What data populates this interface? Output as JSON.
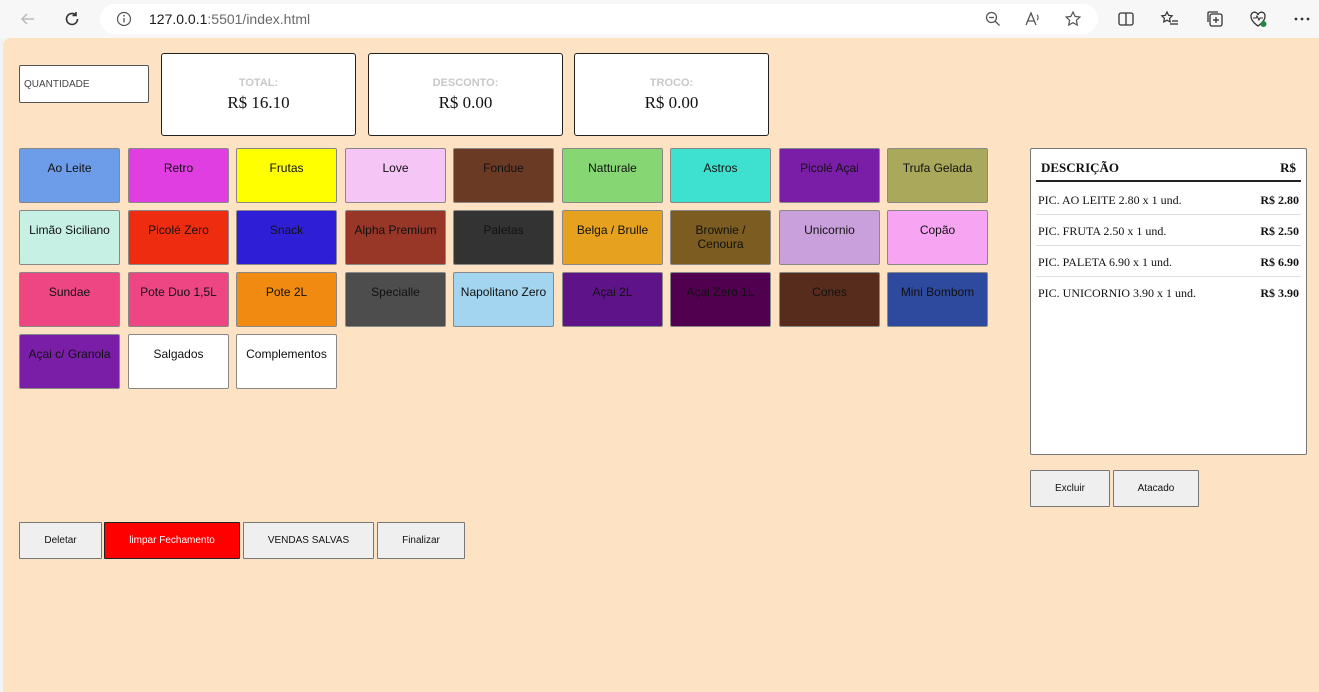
{
  "browser": {
    "url_host": "127.0.0.1",
    "url_path": ":5501/index.html"
  },
  "quantity": {
    "placeholder": "QUANTIDADE"
  },
  "summary": [
    {
      "label": "TOTAL:",
      "value": "R$ 16.10"
    },
    {
      "label": "DESCONTO:",
      "value": "R$ 0.00"
    },
    {
      "label": "TROCO:",
      "value": "R$ 0.00"
    }
  ],
  "products": [
    {
      "label": "Ao Leite",
      "color": "#6d9de8"
    },
    {
      "label": "Retro",
      "color": "#e03ee0"
    },
    {
      "label": "Frutas",
      "color": "#ffff00"
    },
    {
      "label": "Love",
      "color": "#f5c5f5"
    },
    {
      "label": "Fondue",
      "color": "#6b3a25"
    },
    {
      "label": "Natturale",
      "color": "#86d674"
    },
    {
      "label": "Astros",
      "color": "#3ee0d0"
    },
    {
      "label": "Picolé Açai",
      "color": "#7a1ea8"
    },
    {
      "label": "Trufa Gelada",
      "color": "#aaa85a"
    },
    {
      "label": "Limão Siciliano",
      "color": "#c6f0e3"
    },
    {
      "label": "Picolé Zero",
      "color": "#ee2d10"
    },
    {
      "label": "Snack",
      "color": "#2e1fd6"
    },
    {
      "label": "Alpha Premium",
      "color": "#983728"
    },
    {
      "label": "Paletas",
      "color": "#333333"
    },
    {
      "label": "Belga / Brulle",
      "color": "#e6a21e"
    },
    {
      "label": "Brownie / Cenoura",
      "color": "#7c5c20"
    },
    {
      "label": "Unicornio",
      "color": "#c9a0dc"
    },
    {
      "label": "Copão",
      "color": "#f7a5f3"
    },
    {
      "label": "Sundae",
      "color": "#ee4583"
    },
    {
      "label": "Pote Duo 1,5L",
      "color": "#ee4583"
    },
    {
      "label": "Pote 2L",
      "color": "#f08a10"
    },
    {
      "label": "Specialle",
      "color": "#4d4d4d"
    },
    {
      "label": "Napolitano Zero",
      "color": "#a3d5f0"
    },
    {
      "label": "Açai 2L",
      "color": "#5e1488"
    },
    {
      "label": "Açai Zero 1L",
      "color": "#51004f"
    },
    {
      "label": "Cones",
      "color": "#582c1c"
    },
    {
      "label": "Mini Bombom",
      "color": "#2e4a9e"
    },
    {
      "label": "Açai c/ Granola",
      "color": "#7a1ea8"
    },
    {
      "label": "Salgados",
      "color": "#ffffff"
    },
    {
      "label": "Complementos",
      "color": "#ffffff"
    }
  ],
  "actions": {
    "delete": "Deletar",
    "clear": "limpar Fechamento",
    "saved": "VENDAS SALVAS",
    "finish": "Finalizar"
  },
  "description": {
    "header_desc": "DESCRIÇÃO",
    "header_price": "R$",
    "items": [
      {
        "desc": "PIC. AO LEITE 2.80 x 1 und.",
        "price": "R$ 2.80"
      },
      {
        "desc": "PIC. FRUTA 2.50 x 1 und.",
        "price": "R$ 2.50"
      },
      {
        "desc": "PIC. PALETA 6.90 x 1 und.",
        "price": "R$ 6.90"
      },
      {
        "desc": "PIC. UNICORNIO 3.90 x 1 und.",
        "price": "R$ 3.90"
      }
    ]
  },
  "panel_actions": {
    "exclude": "Excluir",
    "wholesale": "Atacado"
  }
}
